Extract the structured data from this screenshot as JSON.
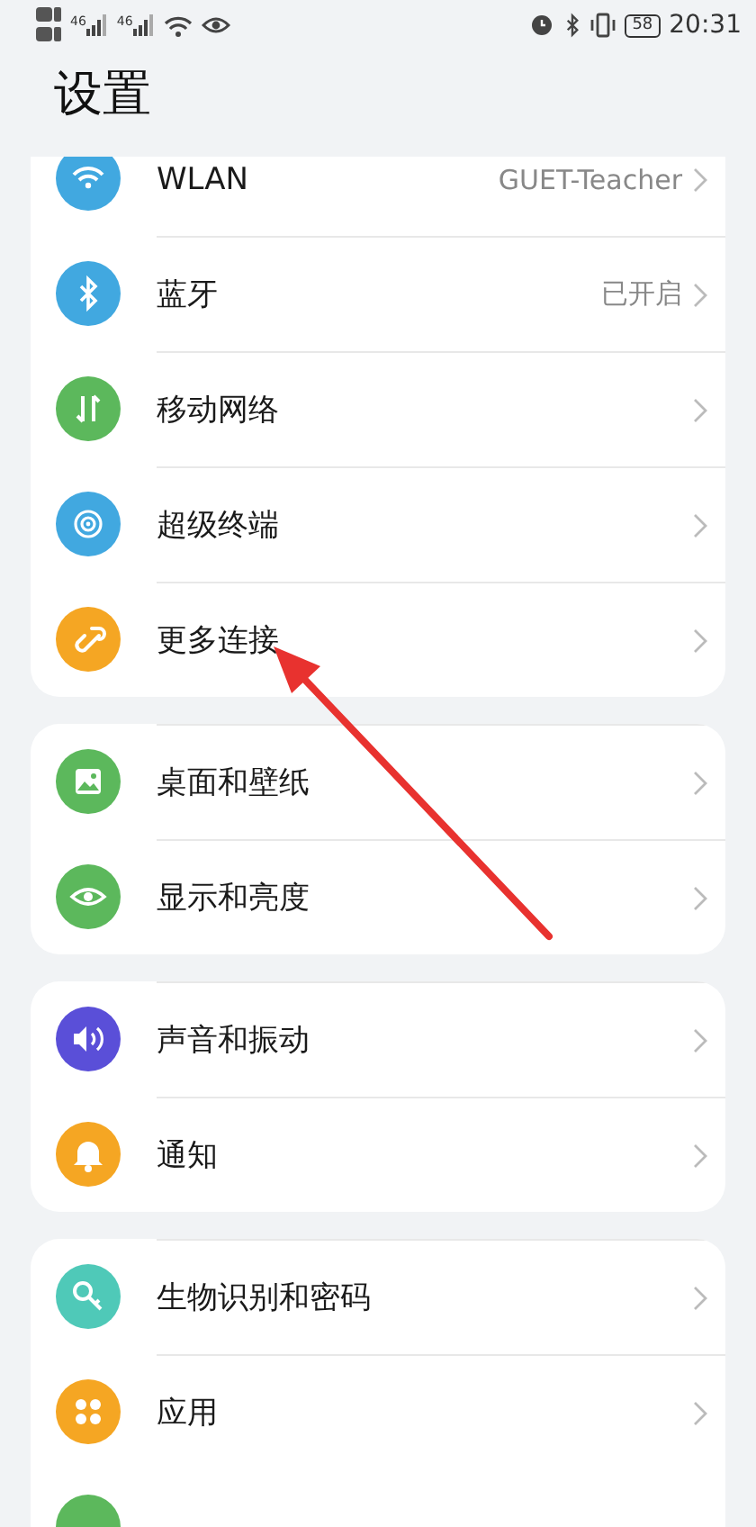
{
  "status_bar": {
    "networks": [
      "46",
      "46"
    ],
    "battery": "58",
    "time": "20:31"
  },
  "title": "设置",
  "groups": [
    {
      "items": [
        {
          "kind": "wifi",
          "color": "#41a8e0",
          "label": "WLAN",
          "value": "GUET-Teacher"
        },
        {
          "kind": "bluetooth",
          "color": "#41a8e0",
          "label": "蓝牙",
          "value": "已开启"
        },
        {
          "kind": "mobile",
          "color": "#5cb85c",
          "label": "移动网络"
        },
        {
          "kind": "device",
          "color": "#41a8e0",
          "label": "超级终端"
        },
        {
          "kind": "link",
          "color": "#f5a623",
          "label": "更多连接"
        }
      ]
    },
    {
      "items": [
        {
          "kind": "wallpaper",
          "color": "#5cb85c",
          "label": "桌面和壁纸"
        },
        {
          "kind": "eye",
          "color": "#5cb85c",
          "label": "显示和亮度"
        }
      ]
    },
    {
      "items": [
        {
          "kind": "sound",
          "color": "#5a4fd8",
          "label": "声音和振动"
        },
        {
          "kind": "bell",
          "color": "#f5a623",
          "label": "通知"
        }
      ]
    },
    {
      "items": [
        {
          "kind": "key",
          "color": "#4fc9b8",
          "label": "生物识别和密码"
        },
        {
          "kind": "apps",
          "color": "#f5a623",
          "label": "应用"
        },
        {
          "kind": "blank",
          "color": "#5cb85c"
        }
      ]
    }
  ],
  "annotation": {
    "kind": "arrow"
  }
}
